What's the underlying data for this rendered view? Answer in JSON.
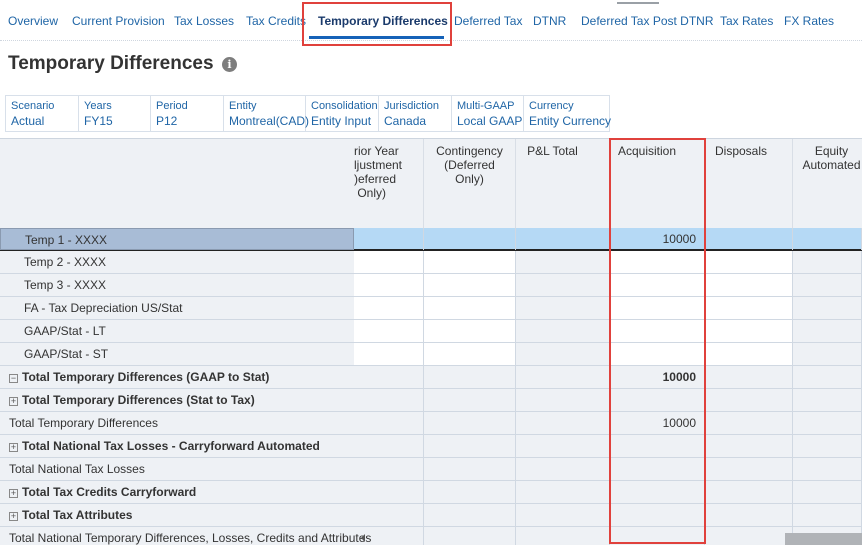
{
  "tabs": [
    {
      "label": "Overview",
      "active": false
    },
    {
      "label": "Current Provision",
      "active": false
    },
    {
      "label": "Tax Losses",
      "active": false
    },
    {
      "label": "Tax Credits",
      "active": false
    },
    {
      "label": "Temporary Differences",
      "active": true
    },
    {
      "label": "Deferred Tax",
      "active": false
    },
    {
      "label": "DTNR",
      "active": false
    },
    {
      "label": "Deferred Tax Post DTNR",
      "active": false
    },
    {
      "label": "Tax Rates",
      "active": false
    },
    {
      "label": "FX Rates",
      "active": false
    }
  ],
  "page": {
    "title": "Temporary Differences",
    "info_icon": "info-icon"
  },
  "pov": [
    {
      "label": "Scenario",
      "value": "Actual"
    },
    {
      "label": "Years",
      "value": "FY15"
    },
    {
      "label": "Period",
      "value": "P12"
    },
    {
      "label": "Entity",
      "value": "Montreal(CAD)"
    },
    {
      "label": "Consolidation",
      "value": "Entity Input"
    },
    {
      "label": "Jurisdiction",
      "value": "Canada"
    },
    {
      "label": "Multi-GAAP",
      "value": "Local GAAP"
    },
    {
      "label": "Currency",
      "value": "Entity Currency"
    }
  ],
  "grid": {
    "columns": [
      "rior Year\nljustment\n)eferred\n Only)",
      "Contingency\n(Deferred\nOnly)",
      "P&L Total",
      "Acquisition",
      "Disposals",
      "Equity\nAutomated"
    ],
    "rows": [
      {
        "label": "Temp 1 - XXXX",
        "values": [
          "",
          "",
          "",
          "10000",
          "",
          ""
        ]
      },
      {
        "label": "Temp 2 - XXXX",
        "values": [
          "",
          "",
          "",
          "",
          "",
          ""
        ]
      },
      {
        "label": "Temp 3 - XXXX",
        "values": [
          "",
          "",
          "",
          "",
          "",
          ""
        ]
      },
      {
        "label": "FA - Tax Depreciation US/Stat",
        "values": [
          "",
          "",
          "",
          "",
          "",
          ""
        ]
      },
      {
        "label": "GAAP/Stat - LT",
        "values": [
          "",
          "",
          "",
          "",
          "",
          ""
        ]
      },
      {
        "label": "GAAP/Stat - ST",
        "values": [
          "",
          "",
          "",
          "",
          "",
          ""
        ]
      },
      {
        "label": "Total Temporary Differences (GAAP to Stat)",
        "expander": "minus",
        "values": [
          "",
          "",
          "",
          "10000",
          "",
          ""
        ]
      },
      {
        "label": "Total Temporary Differences (Stat to Tax)",
        "expander": "plus",
        "values": [
          "",
          "",
          "",
          "",
          "",
          ""
        ]
      },
      {
        "label": "Total Temporary Differences",
        "values": [
          "",
          "",
          "",
          "10000",
          "",
          ""
        ]
      },
      {
        "label": "Total National Tax Losses - Carryforward Automated",
        "expander": "plus",
        "values": [
          "",
          "",
          "",
          "",
          "",
          ""
        ]
      },
      {
        "label": "Total National Tax Losses",
        "values": [
          "",
          "",
          "",
          "",
          "",
          ""
        ]
      },
      {
        "label": "Total Tax Credits Carryforward",
        "expander": "plus",
        "values": [
          "",
          "",
          "",
          "",
          "",
          ""
        ]
      },
      {
        "label": "Total Tax Attributes",
        "expander": "plus",
        "values": [
          "",
          "",
          "",
          "",
          "",
          ""
        ]
      },
      {
        "label": "Total National Temporary Differences, Losses, Credits and Attributes",
        "values": [
          "",
          "",
          "",
          "",
          "",
          ""
        ]
      }
    ]
  },
  "colors": {
    "accent": "#1f65a6",
    "active_tab_underline": "#1562b8",
    "highlight_box": "#e0413c",
    "selected_row": "#b5d9f5"
  }
}
